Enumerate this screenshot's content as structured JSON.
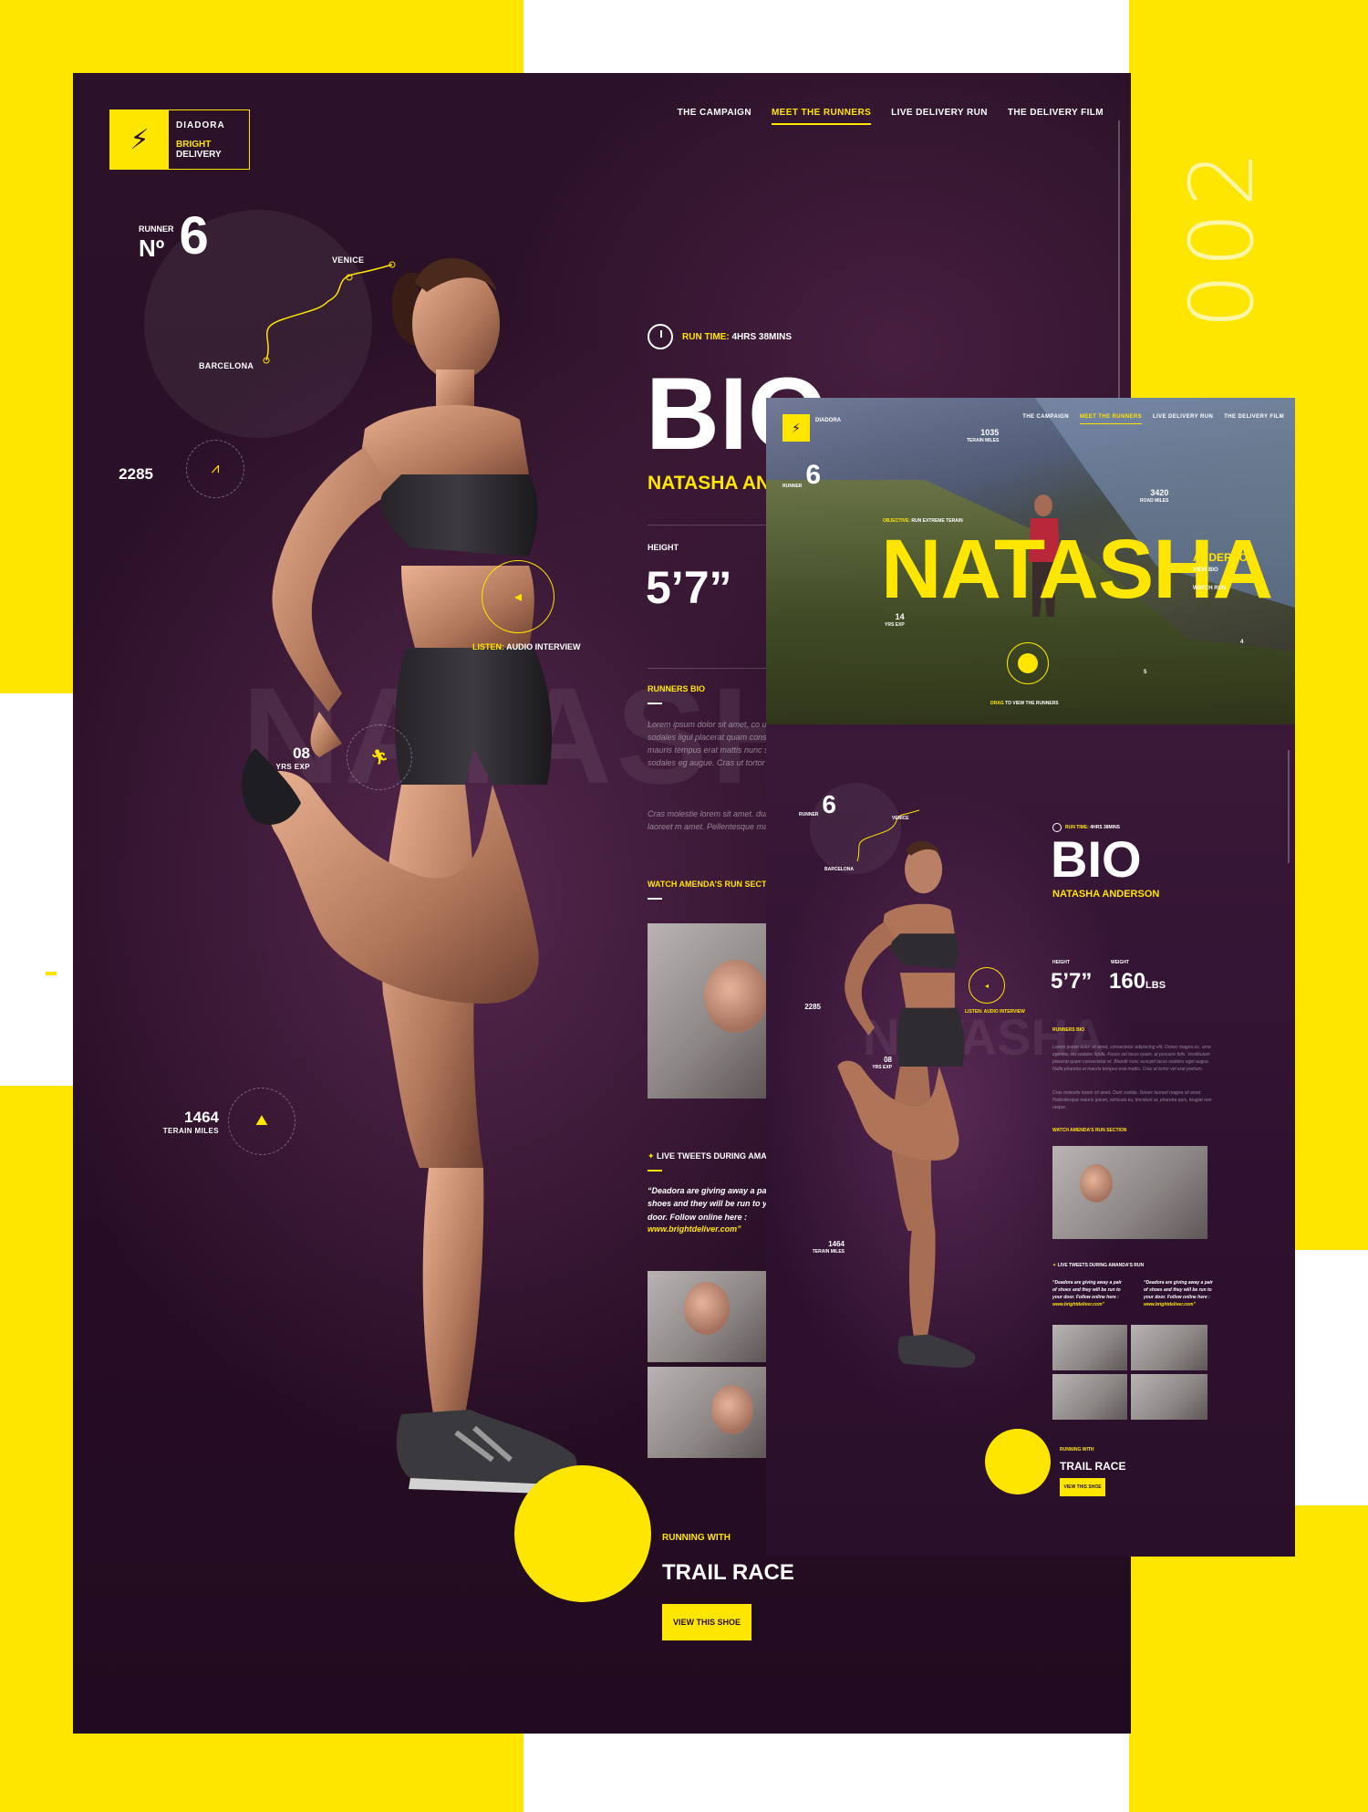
{
  "poster": {
    "number": "002"
  },
  "brand": {
    "name": "DIADORA",
    "product_highlight": "BRIGHT",
    "product_rest": " DELIVERY",
    "bolt": "⚡"
  },
  "nav": [
    {
      "label": "THE CAMPAIGN",
      "active": false
    },
    {
      "label": "MEET THE RUNNERS",
      "active": true
    },
    {
      "label": "LIVE DELIVERY RUN",
      "active": false
    },
    {
      "label": "THE DELIVERY FILM",
      "active": false
    }
  ],
  "runner": {
    "label": "RUNNER",
    "no_symbol": "Nº",
    "number": "6",
    "route_from": "BARCELONA",
    "route_to": "VENICE"
  },
  "stats": {
    "road_miles": "2285",
    "years_exp": "08",
    "years_exp_label": "YRS EXP",
    "terrain_miles": "1464",
    "terrain_label": "TERAIN MILES"
  },
  "audio": {
    "highlight": "LISTEN:",
    "rest": " AUDIO INTERVIEW"
  },
  "bio": {
    "run_time_label": "RUN TIME:",
    "run_time_value": " 4HRS 38MINS",
    "title": "BIO",
    "name_visible": "NATASHA AN",
    "height_label": "HEIGHT",
    "height_value": "5’7”",
    "ghost_name": "NATASHA",
    "runners_bio_label": "RUNNERS BIO",
    "para1": "Lorem ipsum dolor sit amet, co urna egestas, eu sodales ligul placerat quam consectetur et. B et mauris tempus erat mattis nunc suscipit lacus sodales eg augue. Cras ut tortor vel erat",
    "para2": "Cras molestie lorem sit amet. dunt sodale. Donec laoreet m amet. Pellentesque mauris ipsu",
    "watch_label": "WATCH AMENDA’S RUN SECTION",
    "tweets_label": "LIVE TWEETS DURING AMAN",
    "quote": "“Deadora are giving away a pair shoes and they will be run to yo door. Follow online here :",
    "quote_link": "www.brightdeliver.com”",
    "running_with": "RUNNING WITH",
    "shoe_name": "TRAIL RACE",
    "view_shoe": "VIEW THIS SHOE"
  },
  "hero": {
    "brand": "DIADORA",
    "nav": [
      {
        "label": "THE CAMPAIGN",
        "active": false
      },
      {
        "label": "MEET THE RUNNERS",
        "active": true
      },
      {
        "label": "LIVE DELIVERY RUN",
        "active": false
      },
      {
        "label": "THE DELIVERY FILM",
        "active": false
      }
    ],
    "runner_number": "6",
    "runner_label": "RUNNER",
    "objective_label": "OBJECTIVE:",
    "objective_value": " RUN EXTREME TERAIN",
    "first_name": "NATASHA",
    "last_name": "ANDERSON",
    "view_bio": "VIEW BIO",
    "watch_run": "WATCH RUN",
    "terrain_miles": "1035",
    "terrain_label": "TERAIN MILES",
    "road_miles": "3420",
    "road_label": "ROAD MILES",
    "years_exp": "14",
    "years_exp_label": "YRS EXP",
    "marker_a": "4",
    "marker_b": "5",
    "drag_highlight": "DRAG",
    "drag_rest": " TO VIEW THE RUNNERS"
  },
  "mini": {
    "runner_label": "RUNNER",
    "runner_number": "6",
    "route_from": "BARCELONA",
    "route_to": "VENICE",
    "run_time_label": "RUN TIME:",
    "run_time_value": " 4HRS 38MINS",
    "title": "BIO",
    "name": "NATASHA ANDERSON",
    "height_label": "HEIGHT",
    "height_value": "5’7”",
    "weight_label": "WEIGHT",
    "weight_value": "160",
    "weight_unit": "LBS",
    "ghost_name": "NATASHA",
    "road_miles": "2285",
    "years_exp": "08",
    "years_exp_label": "YRS EXP",
    "terrain_miles": "1464",
    "terrain_label": "TERAIN MILES",
    "audio_label": "LISTEN: AUDIO INTERVIEW",
    "runners_bio_label": "RUNNERS BIO",
    "para1": "Lorem ipsum dolor sit amet, consectetur adipiscing elit. Donec magna ex, urna egestas, eu sodales ligula. Fusce vel lacus quam, at posuere felis. Vestibulum placerat quam consectetur et. Blandit nunc suscipit lacus sodales eget augue. Nulla pharetra et mauris tempus erat mattis. Cras ut tortor vel erat pretium.",
    "para2": "Cras molestie lorem sit amet. Dunt sodale. Donec laoreet magna sit amet. Pellentesque mauris ipsum, vehicula eu, tincidunt at, pharetra quis, feugiat non neque.",
    "watch_label": "WATCH AMENDA’S RUN SECTION",
    "tweets_label": "LIVE TWEETS DURING AMANDA’S RUN",
    "quote1": "“Deadora are giving away a pair of shoes and they will be run to your door. Follow online here :",
    "quote1_link": "www.brightdeliver.com”",
    "quote2": "“Deadora are giving away a pair of shoes and they will be run to your door. Follow online here :",
    "quote2_link": "www.brightdeliver.com”",
    "running_with": "RUNNING WITH",
    "shoe_name": "TRAIL RACE",
    "view_shoe": "VIEW THIS SHOE"
  },
  "colors": {
    "accent": "#ffe600",
    "page_bg": "#2a0f27",
    "text": "#ffffff"
  }
}
